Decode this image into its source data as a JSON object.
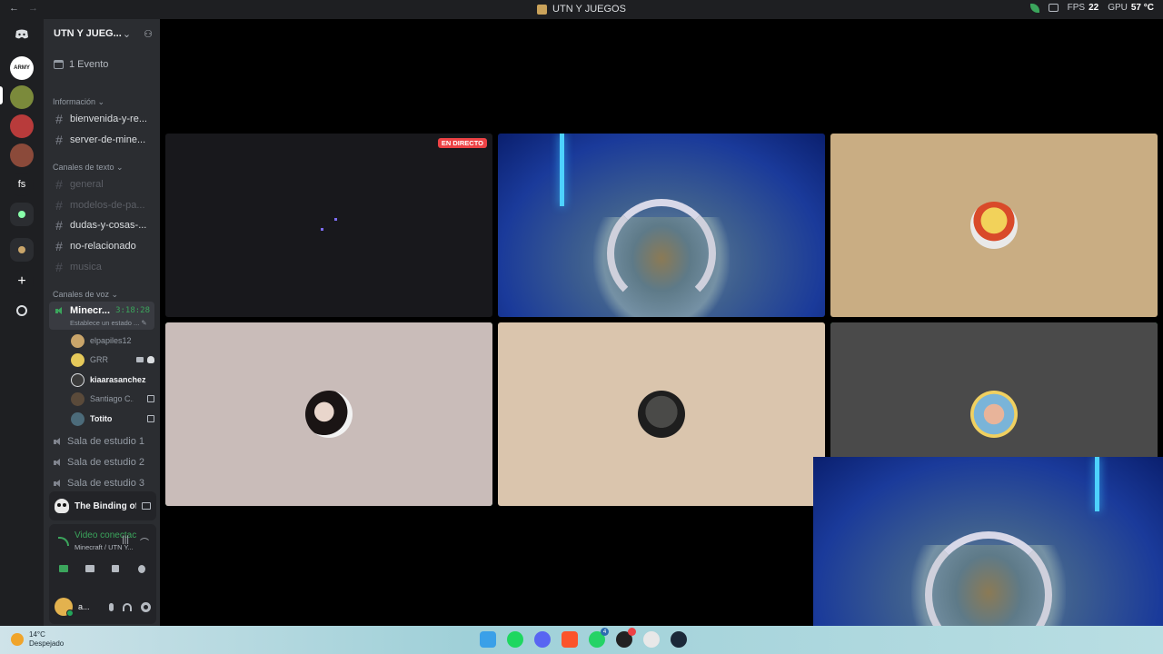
{
  "titlebar": {
    "back": "←",
    "forward": "→",
    "title": "UTN Y JUEGOS",
    "fps_label": "FPS",
    "fps_value": "22",
    "gpu_label": "GPU",
    "gpu_value": "57 °C"
  },
  "rail": {
    "servers": [
      "discord-home",
      "army",
      "frog",
      "red",
      "pixel",
      "fs",
      "k-group",
      "mixed",
      "add",
      "discover"
    ],
    "fs_label": "fs",
    "add": "+"
  },
  "server": {
    "name": "UTN Y JUEG...",
    "event": "1 Evento"
  },
  "categories": {
    "info": "Información ⌄",
    "text": "Canales de texto ⌄",
    "voice": "Canales de voz ⌄"
  },
  "text_channels": [
    {
      "name": "bienvenida-y-re..."
    },
    {
      "name": "server-de-mine..."
    },
    {
      "name": "general"
    },
    {
      "name": "modelos-de-pa..."
    },
    {
      "name": "dudas-y-cosas-..."
    },
    {
      "name": "no-relacionado"
    },
    {
      "name": "musica"
    }
  ],
  "voice_channel": {
    "name": "Minecr...",
    "timer": "3:18:28",
    "status": "Establece un estado ... ✎"
  },
  "voice_users": [
    {
      "name": "elpapiles12",
      "color": "#c9a56a"
    },
    {
      "name": "GRR",
      "color": "#e5c95a"
    },
    {
      "name": "kiaarasanchez",
      "color": "#3a3a3a"
    },
    {
      "name": "Santiago C...",
      "color": "#5a4a3a"
    },
    {
      "name": "Totito",
      "color": "#4c6b7a"
    }
  ],
  "study_rooms": [
    "Sala de estudio 1",
    "Sala de estudio 2",
    "Sala de estudio 3"
  ],
  "activity": {
    "game": "The Binding of Isaa..."
  },
  "rtc": {
    "status": "Video conectac",
    "location": "Minecraft / UTN Y..."
  },
  "user": {
    "name": "a..."
  },
  "stream": {
    "live_label": "EN DIRECTO"
  },
  "tiles": {
    "tan_bg": "#c9ad83",
    "girl_bg": "#c9bcb9",
    "cat_bg": "#dac5ad",
    "baby_bg": "#4a4a4a"
  },
  "taskbar": {
    "temp": "14°C",
    "weather": "Despejado",
    "whatsapp_badge": "4"
  },
  "colors": {
    "accent_green": "#3ba55c",
    "live_red": "#ed4245"
  }
}
